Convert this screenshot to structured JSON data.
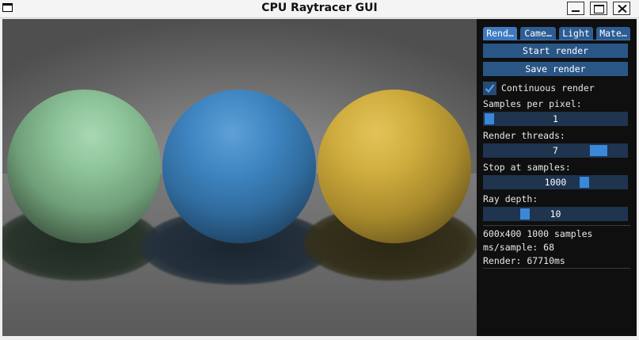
{
  "window": {
    "title": "CPU Raytracer GUI"
  },
  "viewport": {
    "spheres": [
      "green",
      "blue",
      "yellow"
    ]
  },
  "panel": {
    "tabs": [
      {
        "label": "Rend…",
        "active": true
      },
      {
        "label": "Came…",
        "active": false
      },
      {
        "label": "Light",
        "active": false
      },
      {
        "label": "Mate…",
        "active": false
      }
    ],
    "start_render_label": "Start render",
    "save_render_label": "Save render",
    "continuous_render": {
      "label": "Continuous render",
      "checked": true
    },
    "samples_per_pixel": {
      "label": "Samples per pixel:",
      "value": "1",
      "fraction": 0.0
    },
    "render_threads": {
      "label": "Render threads:",
      "value": "7",
      "fraction": 0.85
    },
    "stop_at_samples": {
      "label": "Stop at samples:",
      "value": "1000",
      "fraction": 0.72
    },
    "ray_depth": {
      "label": "Ray depth:",
      "value": "10",
      "fraction": 0.27
    },
    "info": {
      "resolution_samples": "600x400 1000 samples",
      "ms_per_sample": "ms/sample: 68",
      "render_time": "Render: 67710ms"
    }
  },
  "colors": {
    "button": "#2a5686",
    "slider_bg": "#1e344f",
    "slider_grab": "#3a88d9",
    "panel_bg": "#0f0f0f"
  }
}
